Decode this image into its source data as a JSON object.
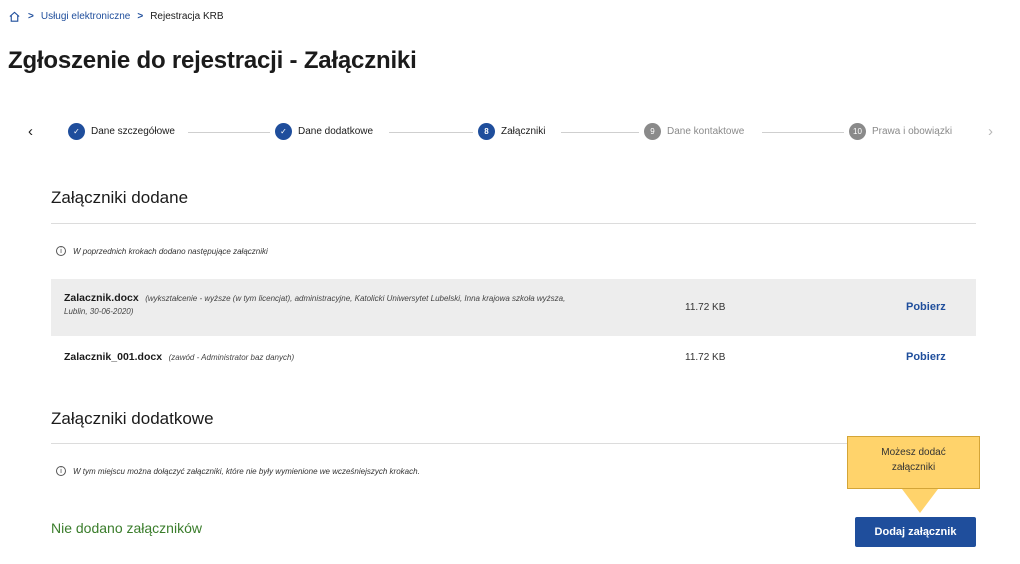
{
  "breadcrumb": {
    "icon": "home-icon",
    "items": [
      "Usługi elektroniczne",
      "Rejestracja KRB"
    ]
  },
  "page_title": "Zgłoszenie do rejestracji - Załączniki",
  "stepper": {
    "steps": [
      {
        "marker": "✓",
        "label": "Dane szczegółowe",
        "state": "done"
      },
      {
        "marker": "✓",
        "label": "Dane dodatkowe",
        "state": "done"
      },
      {
        "marker": "8",
        "label": "Załączniki",
        "state": "active"
      },
      {
        "marker": "9",
        "label": "Dane kontaktowe",
        "state": "future"
      },
      {
        "marker": "10",
        "label": "Prawa i obowiązki",
        "state": "future"
      }
    ]
  },
  "added_section": {
    "title": "Załączniki dodane",
    "info": "W poprzednich krokach dodano następujące załączniki",
    "files": [
      {
        "name": "Zalacznik.docx",
        "meta": "(wykształcenie - wyższe (w tym licencjat), administracyjne, Katolicki Uniwersytet Lubelski, Inna krajowa szkoła wyższa, Lublin, 30-06-2020)",
        "size": "11.72 KB",
        "action": "Pobierz"
      },
      {
        "name": "Zalacznik_001.docx",
        "meta": "(zawód - Administrator baz danych)",
        "size": "11.72 KB",
        "action": "Pobierz"
      }
    ]
  },
  "additional_section": {
    "title": "Załączniki dodatkowe",
    "info": "W tym miejscu można dołączyć załączniki, które nie były wymienione we wcześniejszych krokach.",
    "empty_text": "Nie dodano załączników",
    "add_button": "Dodaj załącznik"
  },
  "tooltip": {
    "line1": "Możesz dodać",
    "line2": "załączniki"
  },
  "colors": {
    "primary": "#1f4e9c",
    "empty_text": "#3a7d2b",
    "tooltip_bg": "#ffd36b",
    "row_shade": "#ededed"
  }
}
